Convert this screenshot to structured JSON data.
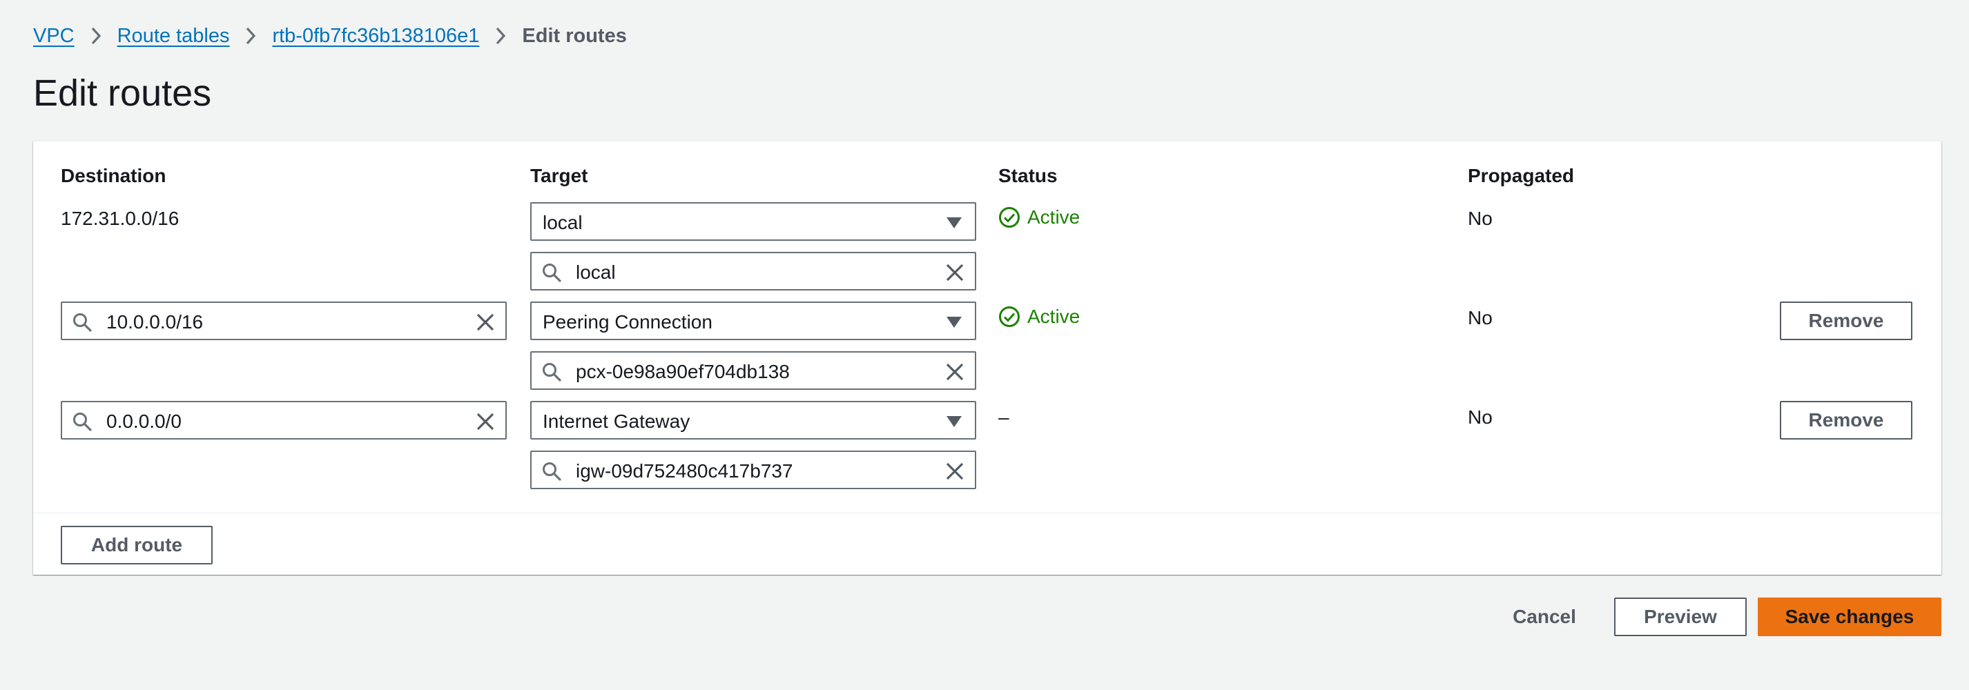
{
  "breadcrumb": {
    "items": [
      {
        "label": "VPC"
      },
      {
        "label": "Route tables"
      },
      {
        "label": "rtb-0fb7fc36b138106e1"
      }
    ],
    "current": "Edit routes"
  },
  "page": {
    "title": "Edit routes"
  },
  "table": {
    "headers": {
      "destination": "Destination",
      "target": "Target",
      "status": "Status",
      "propagated": "Propagated"
    },
    "routes": [
      {
        "destination": "172.31.0.0/16",
        "destination_editable": false,
        "target_type": "local",
        "target_value": "local",
        "status": "Active",
        "propagated": "No",
        "removable": false
      },
      {
        "destination": "10.0.0.0/16",
        "destination_editable": true,
        "target_type": "Peering Connection",
        "target_value": "pcx-0e98a90ef704db138",
        "status": "Active",
        "propagated": "No",
        "removable": true,
        "remove_label": "Remove"
      },
      {
        "destination": "0.0.0.0/0",
        "destination_editable": true,
        "target_type": "Internet Gateway",
        "target_value": "igw-09d752480c417b737",
        "status": "–",
        "propagated": "No",
        "removable": true,
        "remove_label": "Remove"
      }
    ]
  },
  "actions": {
    "add_route": "Add route",
    "cancel": "Cancel",
    "preview": "Preview",
    "save": "Save changes"
  },
  "colors": {
    "link": "#0073bb",
    "status_active": "#1d8102",
    "primary_button": "#ec7211",
    "page_background": "#f2f3f3"
  },
  "icons": {
    "search": "search-icon",
    "clear": "close-icon",
    "dropdown": "caret-down-icon",
    "status_ok": "status-positive-icon",
    "separator": "chevron-right-icon"
  }
}
